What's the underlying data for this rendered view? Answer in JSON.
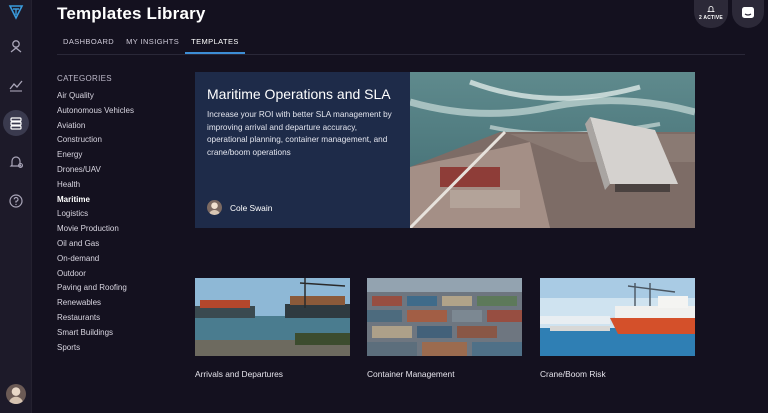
{
  "header": {
    "title": "Templates Library"
  },
  "tabs": [
    {
      "label": "DASHBOARD"
    },
    {
      "label": "MY INSIGHTS"
    },
    {
      "label": "TEMPLATES"
    }
  ],
  "alerts": {
    "label": "2 ACTIVE",
    "icon": "bell-icon"
  },
  "messages": {
    "icon": "chat-icon"
  },
  "rail": {
    "icons": [
      "logo-icon",
      "map-pin-icon",
      "trend-chart-icon",
      "templates-stack-icon",
      "bell-alert-icon",
      "help-icon",
      "user-avatar"
    ]
  },
  "categories": {
    "header": "CATEGORIES",
    "items": [
      "Air Quality",
      "Autonomous Vehicles",
      "Aviation",
      "Construction",
      "Energy",
      "Drones/UAV",
      "Health",
      "Maritime",
      "Logistics",
      "Movie Production",
      "Oil and Gas",
      "On-demand",
      "Outdoor",
      "Paving and Roofing",
      "Renewables",
      "Restaurants",
      "Smart Buildings",
      "Sports"
    ],
    "selected": "Maritime"
  },
  "featured": {
    "title": "Maritime Operations and SLA",
    "description": "Increase your ROI with better SLA management by improving arrival and departure accuracy, operational planning, container management, and crane/boom operations",
    "author": "Cole Swain"
  },
  "cards": [
    {
      "label": "Arrivals and Departures"
    },
    {
      "label": "Container Management"
    },
    {
      "label": "Crane/Boom Risk"
    }
  ],
  "colors": {
    "background": "#14111f",
    "rail": "#1d1a29",
    "featured_panel": "#1e2b49",
    "tab_accent": "#3d8ed6",
    "logo_accent": "#3a9bdc"
  }
}
